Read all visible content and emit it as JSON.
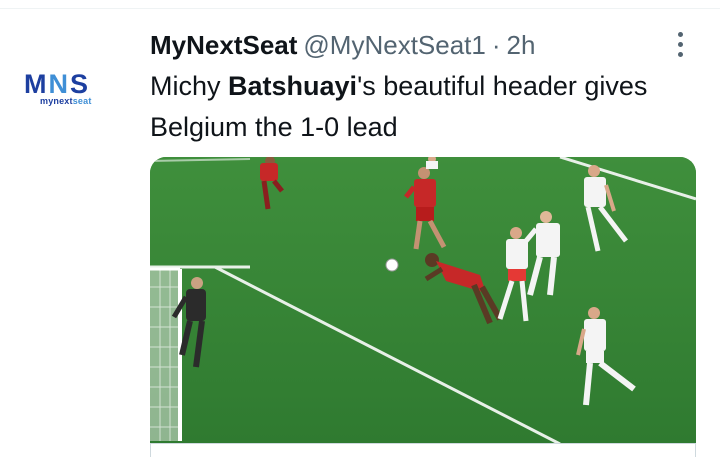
{
  "tweet": {
    "author": {
      "display_name": "MyNextSeat",
      "handle": "@MyNextSeat1",
      "separator": "·",
      "time": "2h",
      "avatar": {
        "letter_m": "M",
        "letter_n": "N",
        "letter_s": "S",
        "sub_prefix": "mynext",
        "sub_suffix": "seat"
      }
    },
    "text": {
      "part1": "Michy ",
      "bold": "Batshuayi",
      "part2": "'s beautiful header gives Belgium the 1-0 lead"
    },
    "media": {
      "description_icon": "football-match-photo",
      "pitch_color": "#3d8a3a",
      "belgium_kit_color": "#c62828",
      "poland_kit_color": "#f4f4f4"
    }
  },
  "icons": {
    "more": "vertical-ellipsis"
  }
}
